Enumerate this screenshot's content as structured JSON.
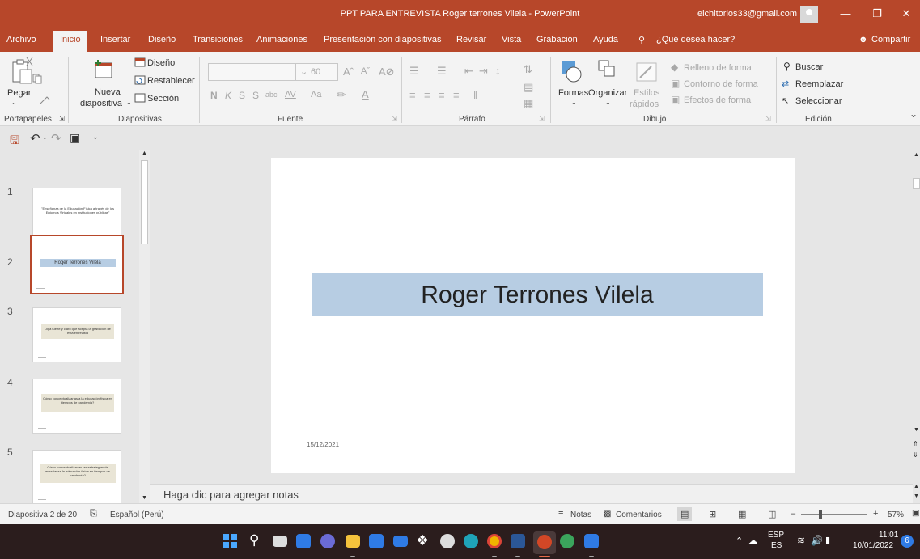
{
  "window": {
    "title": "PPT PARA ENTREVISTA Roger terrones Vilela  -  PowerPoint",
    "user": "elchitorios33@gmail.com"
  },
  "tabs": [
    "Archivo",
    "Inicio",
    "Insertar",
    "Diseño",
    "Transiciones",
    "Animaciones",
    "Presentación con diapositivas",
    "Revisar",
    "Vista",
    "Grabación",
    "Ayuda"
  ],
  "tell_me": "¿Qué desea hacer?",
  "share": "Compartir",
  "ribbon": {
    "clipboard": {
      "paste": "Pegar",
      "label": "Portapapeles"
    },
    "slides": {
      "new_slide_1": "Nueva",
      "new_slide_2": "diapositiva",
      "layout": "Diseño",
      "reset": "Restablecer",
      "section": "Sección",
      "label": "Diapositivas"
    },
    "font": {
      "size": "60",
      "label": "Fuente",
      "bold": "N",
      "italic": "K",
      "underline": "S",
      "shadow": "S",
      "strike": "abc",
      "spacing": "AV",
      "case": "Aa"
    },
    "paragraph": {
      "label": "Párrafo"
    },
    "drawing": {
      "shapes": "Formas",
      "arrange": "Organizar",
      "styles_1": "Estilos",
      "styles_2": "rápidos",
      "fill": "Relleno de forma",
      "outline": "Contorno de forma",
      "effects": "Efectos de forma",
      "label": "Dibujo"
    },
    "editing": {
      "find": "Buscar",
      "replace": "Reemplazar",
      "select": "Seleccionar",
      "label": "Edición"
    }
  },
  "thumbnails": [
    {
      "num": "1",
      "text": "\"Enseñanza de la Educación Física a través de los Entornos Virtuales en instituciones públicas\""
    },
    {
      "num": "2",
      "text": "Roger Terrones Vilela"
    },
    {
      "num": "3",
      "text": "Diga fuerte y claro que acepta la grabación de esta entrevista"
    },
    {
      "num": "4",
      "text": "Cómo conceptualizarías a la educación física en tiempos de pandemia?"
    },
    {
      "num": "5",
      "text": "Cómo conceptualizarías las estrategias de enseñanza la educación física en tiempos de pandemia?"
    }
  ],
  "slide": {
    "title": "Roger Terrones Vilela",
    "date": "15/12/2021"
  },
  "notes_placeholder": "Haga clic para agregar notas",
  "status": {
    "slide_counter": "Diapositiva 2 de 20",
    "language": "Español (Perú)",
    "notes": "Notas",
    "comments": "Comentarios",
    "zoom": "57%"
  },
  "taskbar": {
    "lang_1": "ESP",
    "lang_2": "ES",
    "time": "11:01",
    "date": "10/01/2022",
    "badge": "6"
  }
}
